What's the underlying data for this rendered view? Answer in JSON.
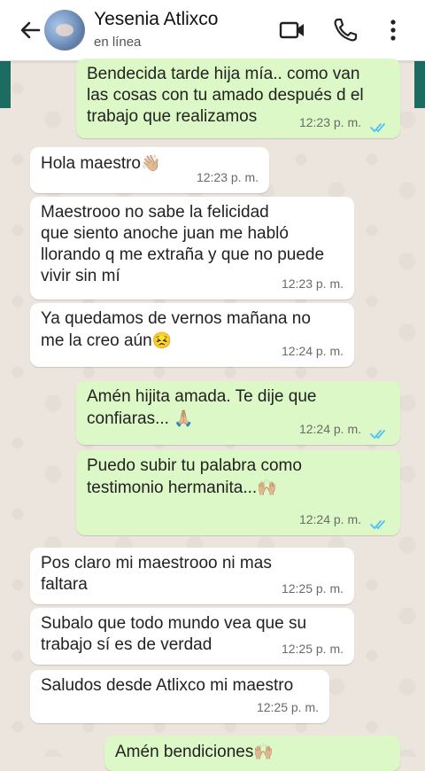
{
  "header": {
    "back_icon": "arrow-left-icon",
    "contact_name": "Yesenia Atlixco",
    "status": "en línea",
    "actions": [
      "video-call-icon",
      "phone-icon",
      "more-vert-icon"
    ]
  },
  "messages": [
    {
      "dir": "out",
      "text": "Bendecida tarde hija mía.. como van\nlas cosas con tu amado después d el\ntrabajo que realizamos",
      "time": "12:23 p. m.",
      "read": true
    },
    {
      "dir": "in",
      "text": "Hola maestro",
      "emoji": "👋🏼",
      "time": "12:23 p. m."
    },
    {
      "dir": "in",
      "text": "Maestrooo no sabe la felicidad\nque siento anoche juan me habló\nllorando q me extraña y que no puede\nvivir sin mí",
      "time": "12:23 p. m."
    },
    {
      "dir": "in",
      "text": "Ya quedamos de vernos mañana no\nme la creo aún",
      "emoji": "😣",
      "time": "12:24 p. m."
    },
    {
      "dir": "out",
      "text": "Amén hijita amada. Te dije que\nconfiaras... ",
      "emoji": "🙏🏼",
      "time": "12:24 p. m.",
      "read": true
    },
    {
      "dir": "out",
      "text": "Puedo subir tu palabra como\ntestimonio hermanita...",
      "emoji": "🙌🏼",
      "time": "12:24 p. m.",
      "read": true
    },
    {
      "dir": "in",
      "text": "Pos claro mi maestrooo ni mas\nfaltara",
      "time": "12:25 p. m."
    },
    {
      "dir": "in",
      "text": "Subalo que todo mundo vea que su\ntrabajo sí es de verdad",
      "time": "12:25 p. m."
    },
    {
      "dir": "in",
      "text": "Saludos desde Atlixco mi maestro",
      "time": "12:25 p. m."
    },
    {
      "dir": "out",
      "text": "Amén bendiciones",
      "emoji": "🙌🏼"
    }
  ],
  "colors": {
    "header_bg": "#ffffff",
    "outgoing_bubble": "#dcf8c6",
    "incoming_bubble": "#ffffff",
    "read_tick": "#4fc3f7",
    "wallpaper": "#ece5dd"
  }
}
